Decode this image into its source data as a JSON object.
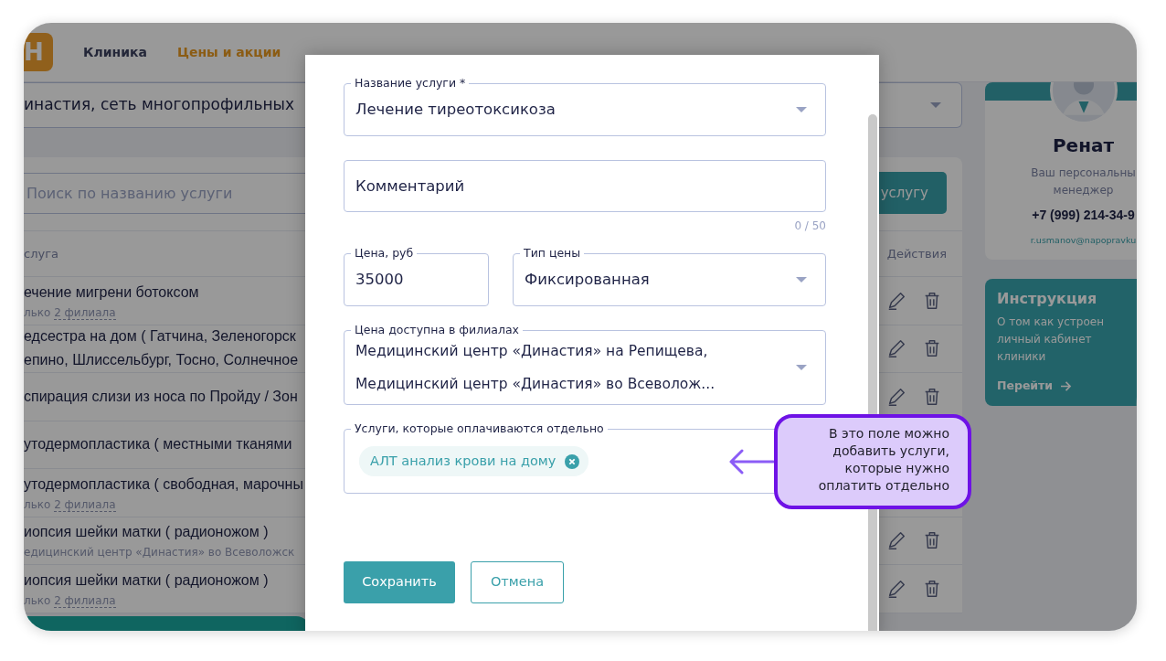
{
  "nav": {
    "logo": "Н",
    "items": [
      {
        "label": "Клиника",
        "selected": false
      },
      {
        "label": "Цены и акции",
        "selected": true
      }
    ]
  },
  "clinic_select": {
    "value": "инастия, сеть многопрофильных"
  },
  "search": {
    "placeholder": "Поиск по названию услуги"
  },
  "add_button": "услугу",
  "table": {
    "columns": [
      "слуга",
      "Действия"
    ],
    "rows": [
      {
        "lines": [
          "ечение мигрени ботоксом"
        ],
        "sub": {
          "kind": "link",
          "before": "лько ",
          "link": "2 филиала"
        }
      },
      {
        "lines": [
          "едсестра на дом ( Гатчина, Зеленогорск",
          "епино, Шлиссельбург, Тосно, Солнечное"
        ]
      },
      {
        "lines": [
          "спирация слизи из носа по Пройду / Зон"
        ]
      },
      {
        "lines": [
          "утодермопластика ( местными тканями"
        ]
      },
      {
        "lines": [
          "утодермопластика ( свободная, марочны"
        ],
        "sub": {
          "kind": "link",
          "before": "лько ",
          "link": "2 филиала"
        }
      },
      {
        "lines": [
          "иопсия шейки матки ( радионожом )"
        ],
        "sub": {
          "kind": "text",
          "text": "едицинский центр «Династия» во Всеволожск"
        }
      },
      {
        "lines": [
          "иопсия шейки матки ( радионожом )"
        ],
        "sub": {
          "kind": "link",
          "before": "лько ",
          "link": "2 филиала"
        }
      }
    ]
  },
  "manager": {
    "name": "Ренат",
    "role_lines": [
      "Ваш персональны",
      "менеджер"
    ],
    "phone": "+7 (999) 214-34-9",
    "email": "r.usmanov@napopravku"
  },
  "instruction": {
    "title": "Инструкция",
    "lines": [
      "О том как устроен",
      "личный кабинет",
      "клиники"
    ],
    "link": "Перейти"
  },
  "modal": {
    "service_name": {
      "label": "Название услуги *",
      "value": "Лечение тиреотоксикоза"
    },
    "comment": {
      "placeholder": "Комментарий",
      "counter": "0 / 50"
    },
    "price": {
      "label": "Цена, руб",
      "value": "35000"
    },
    "price_type": {
      "label": "Тип цены",
      "value": "Фиксированная"
    },
    "branches": {
      "label": "Цена доступна в филиалах",
      "values": [
        "Медицинский центр «Династия» на Репищева,",
        "Медицинский центр «Династия» во Всеволож..."
      ]
    },
    "extra_services": {
      "label": "Услуги, которые оплачиваются отдельно",
      "chips": [
        "АЛТ анализ крови на дому"
      ]
    },
    "buttons": [
      {
        "label": "Сохранить",
        "kind": "primary"
      },
      {
        "label": "Отмена",
        "kind": "outline"
      }
    ]
  },
  "tooltip": {
    "lines": [
      "В это поле можно",
      "добавить услуги,",
      "которые нужно",
      "оплатить отдельно"
    ]
  }
}
